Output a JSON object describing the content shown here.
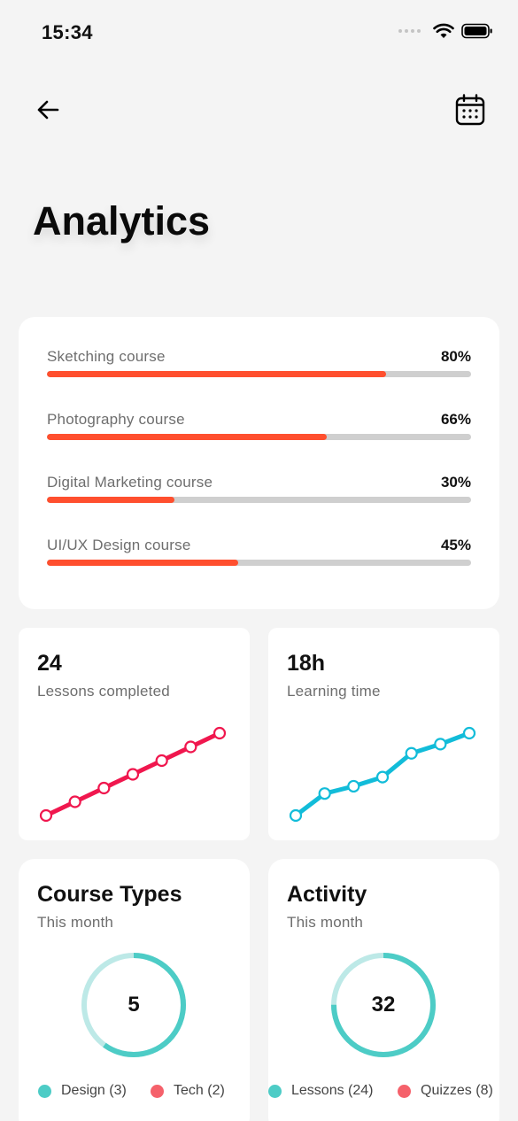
{
  "status": {
    "time": "15:34"
  },
  "header": {
    "back_icon": "arrow-left-icon",
    "calendar_icon": "calendar-icon"
  },
  "page": {
    "title": "Analytics"
  },
  "colors": {
    "progress": "#ff4f2e",
    "track": "#cfcfcf",
    "lessons_line": "#f0174e",
    "time_line": "#12bcd9",
    "donut_main": "#4dccc6",
    "donut_light": "#bde9e7",
    "legend_red": "#f5616b"
  },
  "courses": [
    {
      "name": "Sketching course",
      "percent_label": "80%",
      "percent": 80
    },
    {
      "name": "Photography course",
      "percent_label": "66%",
      "percent": 66
    },
    {
      "name": "Digital Marketing course",
      "percent_label": "30%",
      "percent": 30
    },
    {
      "name": "UI/UX Design course",
      "percent_label": "45%",
      "percent": 45
    }
  ],
  "stats": {
    "lessons": {
      "value": "24",
      "label": "Lessons completed",
      "trend": [
        0,
        1,
        2,
        3,
        4,
        5,
        6
      ]
    },
    "time": {
      "value": "18h",
      "label": "Learning time",
      "trend": [
        0,
        1.2,
        1.6,
        2.1,
        3.4,
        3.9,
        4.5
      ]
    }
  },
  "course_types": {
    "title": "Course Types",
    "subtitle": "This month",
    "total": "5",
    "legend": [
      {
        "label": "Design (3)",
        "value": 3
      },
      {
        "label": "Tech (2)",
        "value": 2
      }
    ]
  },
  "activity": {
    "title": "Activity",
    "subtitle": "This month",
    "total": "32",
    "legend": [
      {
        "label": "Lessons (24)",
        "value": 24
      },
      {
        "label": "Quizzes (8)",
        "value": 8
      }
    ]
  }
}
